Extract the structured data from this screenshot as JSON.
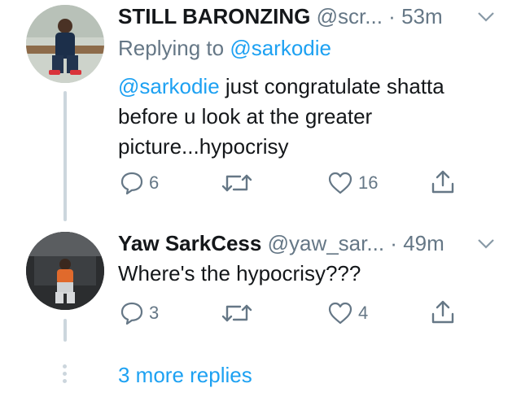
{
  "tweet1": {
    "display_name": "STILL BARONZING",
    "handle": "@scr...",
    "separator": "·",
    "time": "53m",
    "replying_prefix": "Replying to",
    "replying_to": "@sarkodie",
    "mention": "@sarkodie",
    "text_line1": " just congratulate shatta",
    "text_line2": "before u look at the greater",
    "text_line3": "picture...hypocrisy",
    "replies": "6",
    "retweets": "",
    "likes": "16"
  },
  "tweet2": {
    "display_name": "Yaw SarkCess",
    "handle": "@yaw_sar...",
    "separator": "·",
    "time": "49m",
    "text": "Where's the hypocrisy???",
    "replies": "3",
    "retweets": "",
    "likes": "4"
  },
  "more_replies": "3 more replies",
  "colors": {
    "accent": "#1da1f2",
    "muted": "#657786",
    "text": "#14171a",
    "thread_line": "#ccd6dd"
  },
  "icons": [
    "chevron-down-icon",
    "reply-icon",
    "retweet-icon",
    "like-icon",
    "share-icon"
  ]
}
